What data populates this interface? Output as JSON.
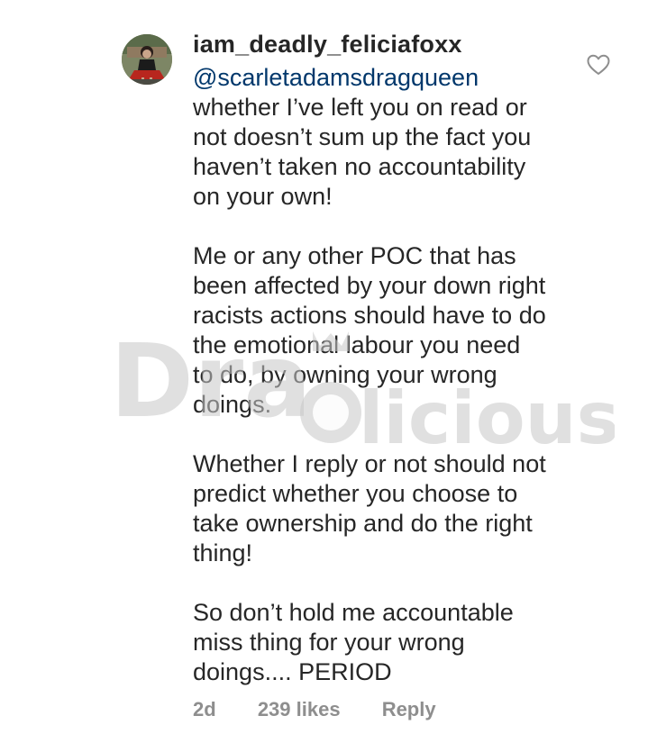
{
  "comment": {
    "username": "iam_deadly_feliciafoxx",
    "mention": "@scarletadamsdragqueen",
    "paragraphs": [
      "whether I’ve left you on read or\nnot doesn’t sum up the fact you\nhaven’t taken no accountability\non your own!",
      "Me or any other POC that has\nbeen affected by your down right\nracists actions should have to do\nthe emotional labour you need\nto do, by owning your wrong\ndoings.",
      "Whether I reply or not should not\npredict whether you choose to\ntake ownership and do the right\nthing!",
      "So don’t hold me accountable\nmiss thing for your wrong\ndoings.... PERIOD"
    ],
    "time": "2d",
    "likes": "239 likes",
    "reply_label": "Reply",
    "like_icon": "heart-outline-icon"
  },
  "watermark": {
    "part1": "Dra",
    "part2": "licious"
  },
  "colors": {
    "text": "#262626",
    "mention": "#00376b",
    "meta": "#8e8e8e",
    "watermark": "#c8c8c8"
  }
}
